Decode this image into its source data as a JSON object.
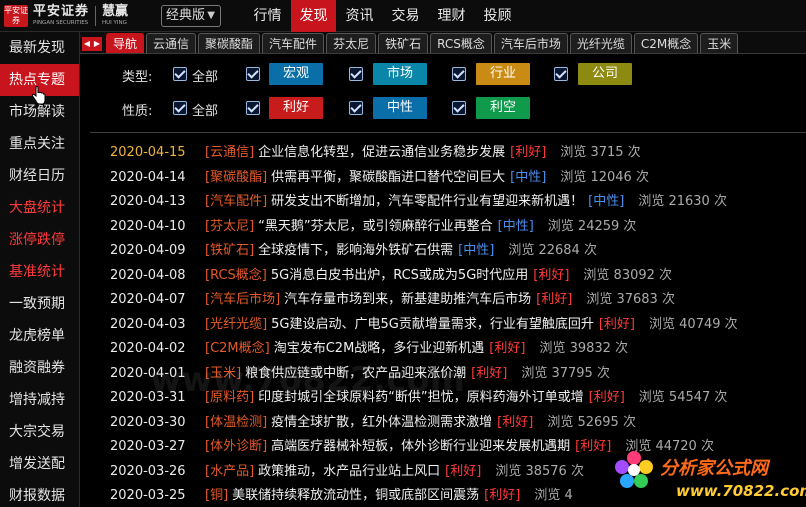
{
  "header": {
    "logo_mark": "平安证券",
    "brand_cn": "平安证券",
    "brand_en": "PINGAN SECURITIES",
    "brand2_cn": "慧赢",
    "brand2_en": "HUI YING",
    "edition": "经典版",
    "nav": [
      "行情",
      "发现",
      "资讯",
      "交易",
      "理财",
      "投顾"
    ],
    "nav_active_index": 1
  },
  "sidebar": {
    "items": [
      {
        "label": "最新发现",
        "style": "normal"
      },
      {
        "label": "热点专题",
        "style": "active"
      },
      {
        "label": "市场解读",
        "style": "normal"
      },
      {
        "label": "重点关注",
        "style": "normal"
      },
      {
        "label": "财经日历",
        "style": "normal"
      },
      {
        "label": "大盘统计",
        "style": "red"
      },
      {
        "label": "涨停跌停",
        "style": "red"
      },
      {
        "label": "基准统计",
        "style": "red"
      },
      {
        "label": "一致预期",
        "style": "normal"
      },
      {
        "label": "龙虎榜单",
        "style": "normal"
      },
      {
        "label": "融资融券",
        "style": "normal"
      },
      {
        "label": "增持减持",
        "style": "normal"
      },
      {
        "label": "大宗交易",
        "style": "normal"
      },
      {
        "label": "增发送配",
        "style": "normal"
      },
      {
        "label": "财报数据",
        "style": "normal"
      }
    ]
  },
  "tabs": {
    "items": [
      "导航",
      "云通信",
      "聚碳酸酯",
      "汽车配件",
      "芬太尼",
      "铁矿石",
      "RCS概念",
      "汽车后市场",
      "光纤光缆",
      "C2M概念",
      "玉米"
    ],
    "active_index": 0
  },
  "filters": {
    "type_label": "类型:",
    "type_all": "全部",
    "type_buttons": [
      {
        "label": "宏观",
        "color": "#0a6ea8"
      },
      {
        "label": "市场",
        "color": "#0a86a8"
      },
      {
        "label": "行业",
        "color": "#c98b14"
      },
      {
        "label": "公司",
        "color": "#8c8a10"
      }
    ],
    "nature_label": "性质:",
    "nature_all": "全部",
    "nature_buttons": [
      {
        "label": "利好",
        "color": "#c81c1c"
      },
      {
        "label": "中性",
        "color": "#0a6ea8"
      },
      {
        "label": "利空",
        "color": "#0f9a4c"
      }
    ]
  },
  "news": [
    {
      "date": "2020-04-15",
      "tag": "[云通信]",
      "title": "企业信息化转型，促进云通信业务稳步发展",
      "sentiment": "[利好]",
      "sentiment_type": "good",
      "views": "浏览 3715 次"
    },
    {
      "date": "2020-04-14",
      "tag": "[聚碳酸酯]",
      "title": "供需再平衡，聚碳酸酯进口替代空间巨大",
      "sentiment": "[中性]",
      "sentiment_type": "mid",
      "views": "浏览 12046 次"
    },
    {
      "date": "2020-04-13",
      "tag": "[汽车配件]",
      "title": "研发支出不断增加，汽车零配件行业有望迎来新机遇！",
      "sentiment": "[中性]",
      "sentiment_type": "mid",
      "views": "浏览 21630 次"
    },
    {
      "date": "2020-04-10",
      "tag": "[芬太尼]",
      "title": "“黑天鹅”芬太尼，或引领麻醉行业再整合",
      "sentiment": "[中性]",
      "sentiment_type": "mid",
      "views": "浏览 24259 次"
    },
    {
      "date": "2020-04-09",
      "tag": "[铁矿石]",
      "title": "全球疫情下，影响海外铁矿石供需",
      "sentiment": "[中性]",
      "sentiment_type": "mid",
      "views": "浏览 22684 次"
    },
    {
      "date": "2020-04-08",
      "tag": "[RCS概念]",
      "title": "5G消息白皮书出炉，RCS或成为5G时代应用",
      "sentiment": "[利好]",
      "sentiment_type": "good",
      "views": "浏览 83092 次"
    },
    {
      "date": "2020-04-07",
      "tag": "[汽车后市场]",
      "title": "汽车存量市场到来，新基建助推汽车后市场",
      "sentiment": "[利好]",
      "sentiment_type": "good",
      "views": "浏览 37683 次"
    },
    {
      "date": "2020-04-03",
      "tag": "[光纤光缆]",
      "title": "5G建设启动、广电5G贡献增量需求，行业有望触底回升",
      "sentiment": "[利好]",
      "sentiment_type": "good",
      "views": "浏览 40749 次"
    },
    {
      "date": "2020-04-02",
      "tag": "[C2M概念]",
      "title": "淘宝发布C2M战略，多行业迎新机遇",
      "sentiment": "[利好]",
      "sentiment_type": "good",
      "views": "浏览 39832 次"
    },
    {
      "date": "2020-04-01",
      "tag": "[玉米]",
      "title": "粮食供应链或中断，农产品迎来涨价潮",
      "sentiment": "[利好]",
      "sentiment_type": "good",
      "views": "浏览 37795 次"
    },
    {
      "date": "2020-03-31",
      "tag": "[原料药]",
      "title": "印度封城引全球原料药“断供”担忧，原料药海外订单或增",
      "sentiment": "[利好]",
      "sentiment_type": "good",
      "views": "浏览 54547 次"
    },
    {
      "date": "2020-03-30",
      "tag": "[体温检测]",
      "title": "疫情全球扩散，红外体温检测需求激增",
      "sentiment": "[利好]",
      "sentiment_type": "good",
      "views": "浏览 52695 次"
    },
    {
      "date": "2020-03-27",
      "tag": "[体外诊断]",
      "title": "高端医疗器械补短板，体外诊断行业迎来发展机遇期",
      "sentiment": "[利好]",
      "sentiment_type": "good",
      "views": "浏览 44720 次"
    },
    {
      "date": "2020-03-26",
      "tag": "[水产品]",
      "title": "政策推动，水产品行业站上风口",
      "sentiment": "[利好]",
      "sentiment_type": "good",
      "views": "浏览 38576 次"
    },
    {
      "date": "2020-03-25",
      "tag": "[铜]",
      "title": "美联储持续释放流动性，铜或底部区间震荡",
      "sentiment": "[利好]",
      "sentiment_type": "good",
      "views": "浏览 4"
    }
  ],
  "watermark": {
    "title": "分析家公式网",
    "url": "www.70822.com"
  },
  "colors": {
    "accent_red": "#c8141c",
    "date_first": "#f0b43c",
    "tag": "#e45a2a",
    "good": "#ff3a3a",
    "neutral": "#4a8ff0"
  }
}
